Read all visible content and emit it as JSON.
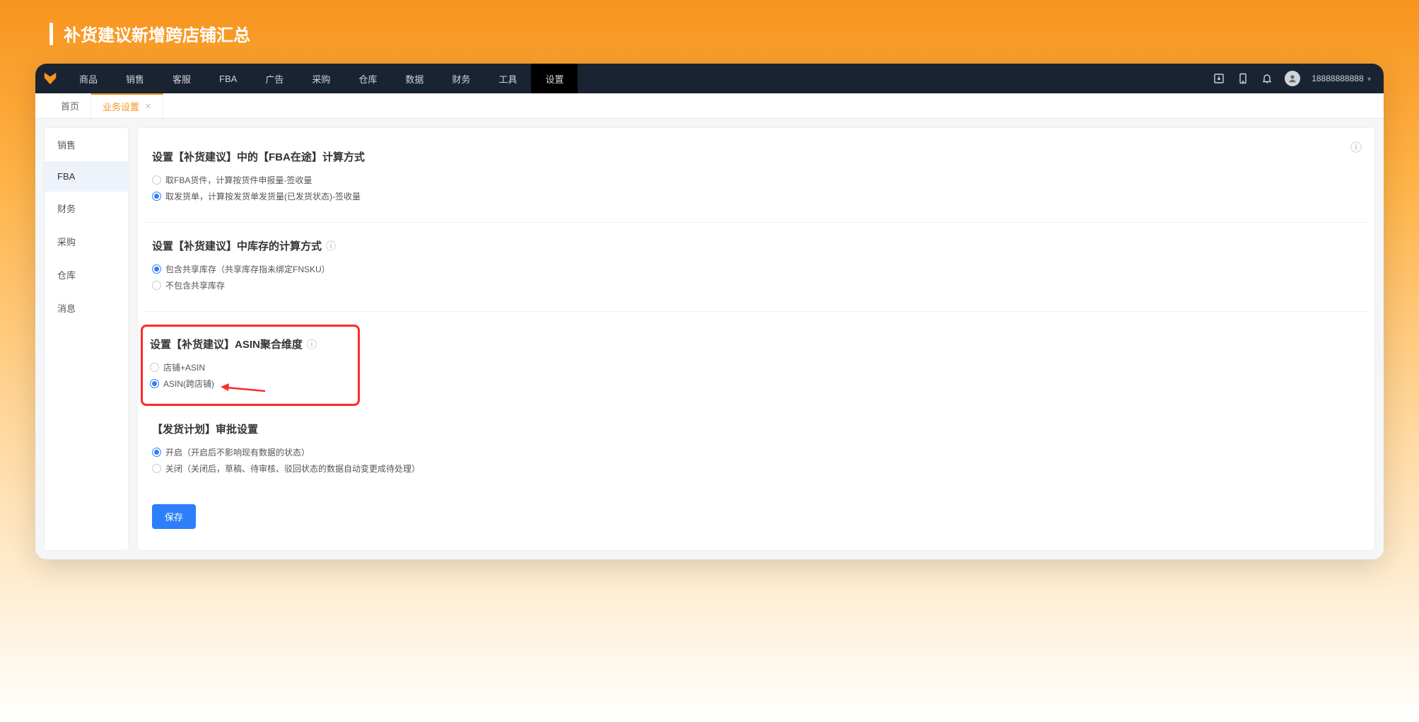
{
  "banner": {
    "title": "补货建议新增跨店铺汇总"
  },
  "topnav": {
    "items": [
      "商品",
      "销售",
      "客服",
      "FBA",
      "广告",
      "采购",
      "仓库",
      "数据",
      "财务",
      "工具",
      "设置"
    ],
    "active_index": 10,
    "user_text": "18888888888"
  },
  "tabs": {
    "items": [
      {
        "label": "首页",
        "closable": false
      },
      {
        "label": "业务设置",
        "closable": true
      }
    ],
    "active_index": 1
  },
  "sidebar": {
    "items": [
      "销售",
      "FBA",
      "财务",
      "采购",
      "仓库",
      "消息"
    ],
    "active_index": 1
  },
  "sections": {
    "s1": {
      "title": "设置【补货建议】中的【FBA在途】计算方式",
      "options": [
        "取FBA货件，计算按货件申报量-签收量",
        "取发货单，计算按发货单发货量(已发货状态)-签收量"
      ],
      "checked": 1
    },
    "s2": {
      "title": "设置【补货建议】中库存的计算方式",
      "help": true,
      "options": [
        "包含共享库存（共享库存指未绑定FNSKU）",
        "不包含共享库存"
      ],
      "checked": 0
    },
    "s3": {
      "title": "设置【补货建议】ASIN聚合维度",
      "help": true,
      "options": [
        "店铺+ASIN",
        "ASIN(跨店铺)"
      ],
      "checked": 1
    },
    "s4": {
      "title": "【发货计划】审批设置",
      "options": [
        "开启（开启后不影响现有数据的状态）",
        "关闭（关闭后，草稿、待审核、驳回状态的数据自动变更成待处理）"
      ],
      "checked": 0
    }
  },
  "buttons": {
    "save": "保存"
  }
}
